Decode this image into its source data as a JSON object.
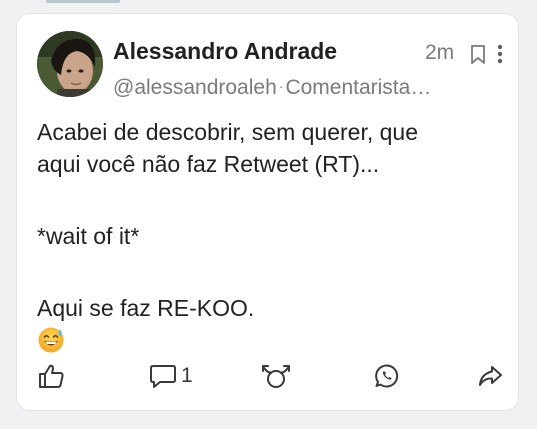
{
  "post": {
    "author_name": "Alessandro Andrade",
    "author_handle": "@alessandroaleh",
    "separator": "·",
    "author_badge": "Comentarista…",
    "time_ago": "2m",
    "lines": [
      "Acabei de descobrir, sem querer, que",
      "aqui você não faz Retweet (RT)...",
      "",
      "*wait of it*",
      "",
      "Aqui se faz RE-KOO."
    ],
    "emoji": "grinning-face-with-sweat-emoji"
  },
  "actions": {
    "like_icon": "thumbs-up-icon",
    "comment_icon": "comment-bubble-icon",
    "comment_count": "1",
    "rekoo_icon": "rekoo-icon",
    "whatsapp_icon": "whatsapp-icon",
    "share_icon": "share-arrow-icon"
  },
  "colors": {
    "background": "#f1f1f3",
    "card": "#ffffff",
    "text": "#222226",
    "muted": "#7a7a7f"
  }
}
